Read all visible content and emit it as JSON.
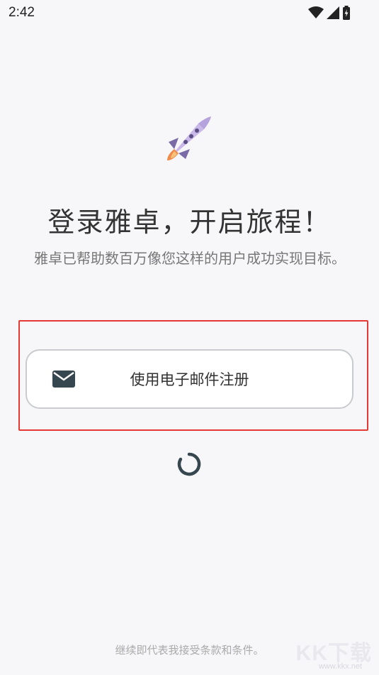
{
  "status_bar": {
    "time": "2:42",
    "icons": [
      "wifi-icon",
      "cellular-signal-icon",
      "battery-charging-icon"
    ]
  },
  "hero": {
    "icon": "rocket-icon",
    "headline": "登录雅卓，开启旅程！",
    "subtitle": "雅卓已帮助数百万像您这样的用户成功实现目标。"
  },
  "signup": {
    "email_button_label": "使用电子邮件注册",
    "email_icon": "mail-icon",
    "highlight_color": "#e53935"
  },
  "loading": {
    "spinner_icon": "loading-spinner-icon"
  },
  "footer": {
    "terms_text": "继续即代表我接受条款和条件。",
    "watermark_logo": "KK下载",
    "watermark_url": "www.kkx.net"
  },
  "colors": {
    "background": "#f7f7f9",
    "text_primary": "#333333",
    "text_secondary": "#777777",
    "rocket_body": "#c9b8e8",
    "rocket_fin": "#7a6ba6",
    "rocket_flame": "#f08a4b"
  }
}
